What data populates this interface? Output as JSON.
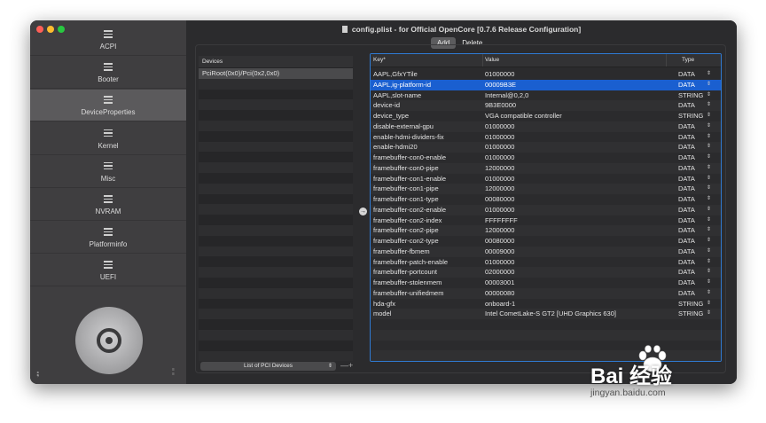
{
  "window": {
    "title": "config.plist - for Official OpenCore [0.7.6 Release Configuration]",
    "add_label": "Add",
    "delete_label": "Delete"
  },
  "sidebar": {
    "items": [
      {
        "label": "ACPI",
        "active": false
      },
      {
        "label": "Booter",
        "active": false
      },
      {
        "label": "DeviceProperties",
        "active": true
      },
      {
        "label": "Kernel",
        "active": false
      },
      {
        "label": "Misc",
        "active": false
      },
      {
        "label": "NVRAM",
        "active": false
      },
      {
        "label": "Platforminfo",
        "active": false
      },
      {
        "label": "UEFI",
        "active": false
      }
    ],
    "icon": "list-icon"
  },
  "devices": {
    "header": "Devices",
    "items": [
      "PciRoot(0x0)/Pci(0x2,0x0)"
    ],
    "select_label": "List of PCI Devices",
    "plus_minus": "—+"
  },
  "table": {
    "columns": {
      "key": "Key*",
      "value": "Value",
      "type": "Type"
    },
    "rows": [
      {
        "key": "AAPL,GfxYTile",
        "value": "01000000",
        "type": "DATA"
      },
      {
        "key": "AAPL,ig-platform-id",
        "value": "00009B3E",
        "type": "DATA",
        "selected": true
      },
      {
        "key": "AAPL,slot-name",
        "value": "Internal@0,2,0",
        "type": "STRING"
      },
      {
        "key": "device-id",
        "value": "9B3E0000",
        "type": "DATA"
      },
      {
        "key": "device_type",
        "value": "VGA compatible controller",
        "type": "STRING"
      },
      {
        "key": "disable-external-gpu",
        "value": "01000000",
        "type": "DATA"
      },
      {
        "key": "enable-hdmi-dividers-fix",
        "value": "01000000",
        "type": "DATA"
      },
      {
        "key": "enable-hdmi20",
        "value": "01000000",
        "type": "DATA"
      },
      {
        "key": "framebuffer-con0-enable",
        "value": "01000000",
        "type": "DATA"
      },
      {
        "key": "framebuffer-con0-pipe",
        "value": "12000000",
        "type": "DATA"
      },
      {
        "key": "framebuffer-con1-enable",
        "value": "01000000",
        "type": "DATA"
      },
      {
        "key": "framebuffer-con1-pipe",
        "value": "12000000",
        "type": "DATA"
      },
      {
        "key": "framebuffer-con1-type",
        "value": "00080000",
        "type": "DATA"
      },
      {
        "key": "framebuffer-con2-enable",
        "value": "01000000",
        "type": "DATA"
      },
      {
        "key": "framebuffer-con2-index",
        "value": "FFFFFFFF",
        "type": "DATA"
      },
      {
        "key": "framebuffer-con2-pipe",
        "value": "12000000",
        "type": "DATA"
      },
      {
        "key": "framebuffer-con2-type",
        "value": "00080000",
        "type": "DATA"
      },
      {
        "key": "framebuffer-fbmem",
        "value": "00009000",
        "type": "DATA"
      },
      {
        "key": "framebuffer-patch-enable",
        "value": "01000000",
        "type": "DATA"
      },
      {
        "key": "framebuffer-portcount",
        "value": "02000000",
        "type": "DATA"
      },
      {
        "key": "framebuffer-stolenmem",
        "value": "00003001",
        "type": "DATA"
      },
      {
        "key": "framebuffer-unifiedmem",
        "value": "00000080",
        "type": "DATA"
      },
      {
        "key": "hda-gfx",
        "value": "onboard-1",
        "type": "STRING"
      },
      {
        "key": "model",
        "value": "Intel CometLake-S GT2 [UHD Graphics 630]",
        "type": "STRING"
      }
    ]
  },
  "watermark": {
    "brand": "Bai  经验",
    "url": "jingyan.baidu.com"
  },
  "colors": {
    "accent": "#1a5fd0",
    "sidebar_bg": "#3f3e40",
    "window_bg": "#2b2b2d"
  }
}
